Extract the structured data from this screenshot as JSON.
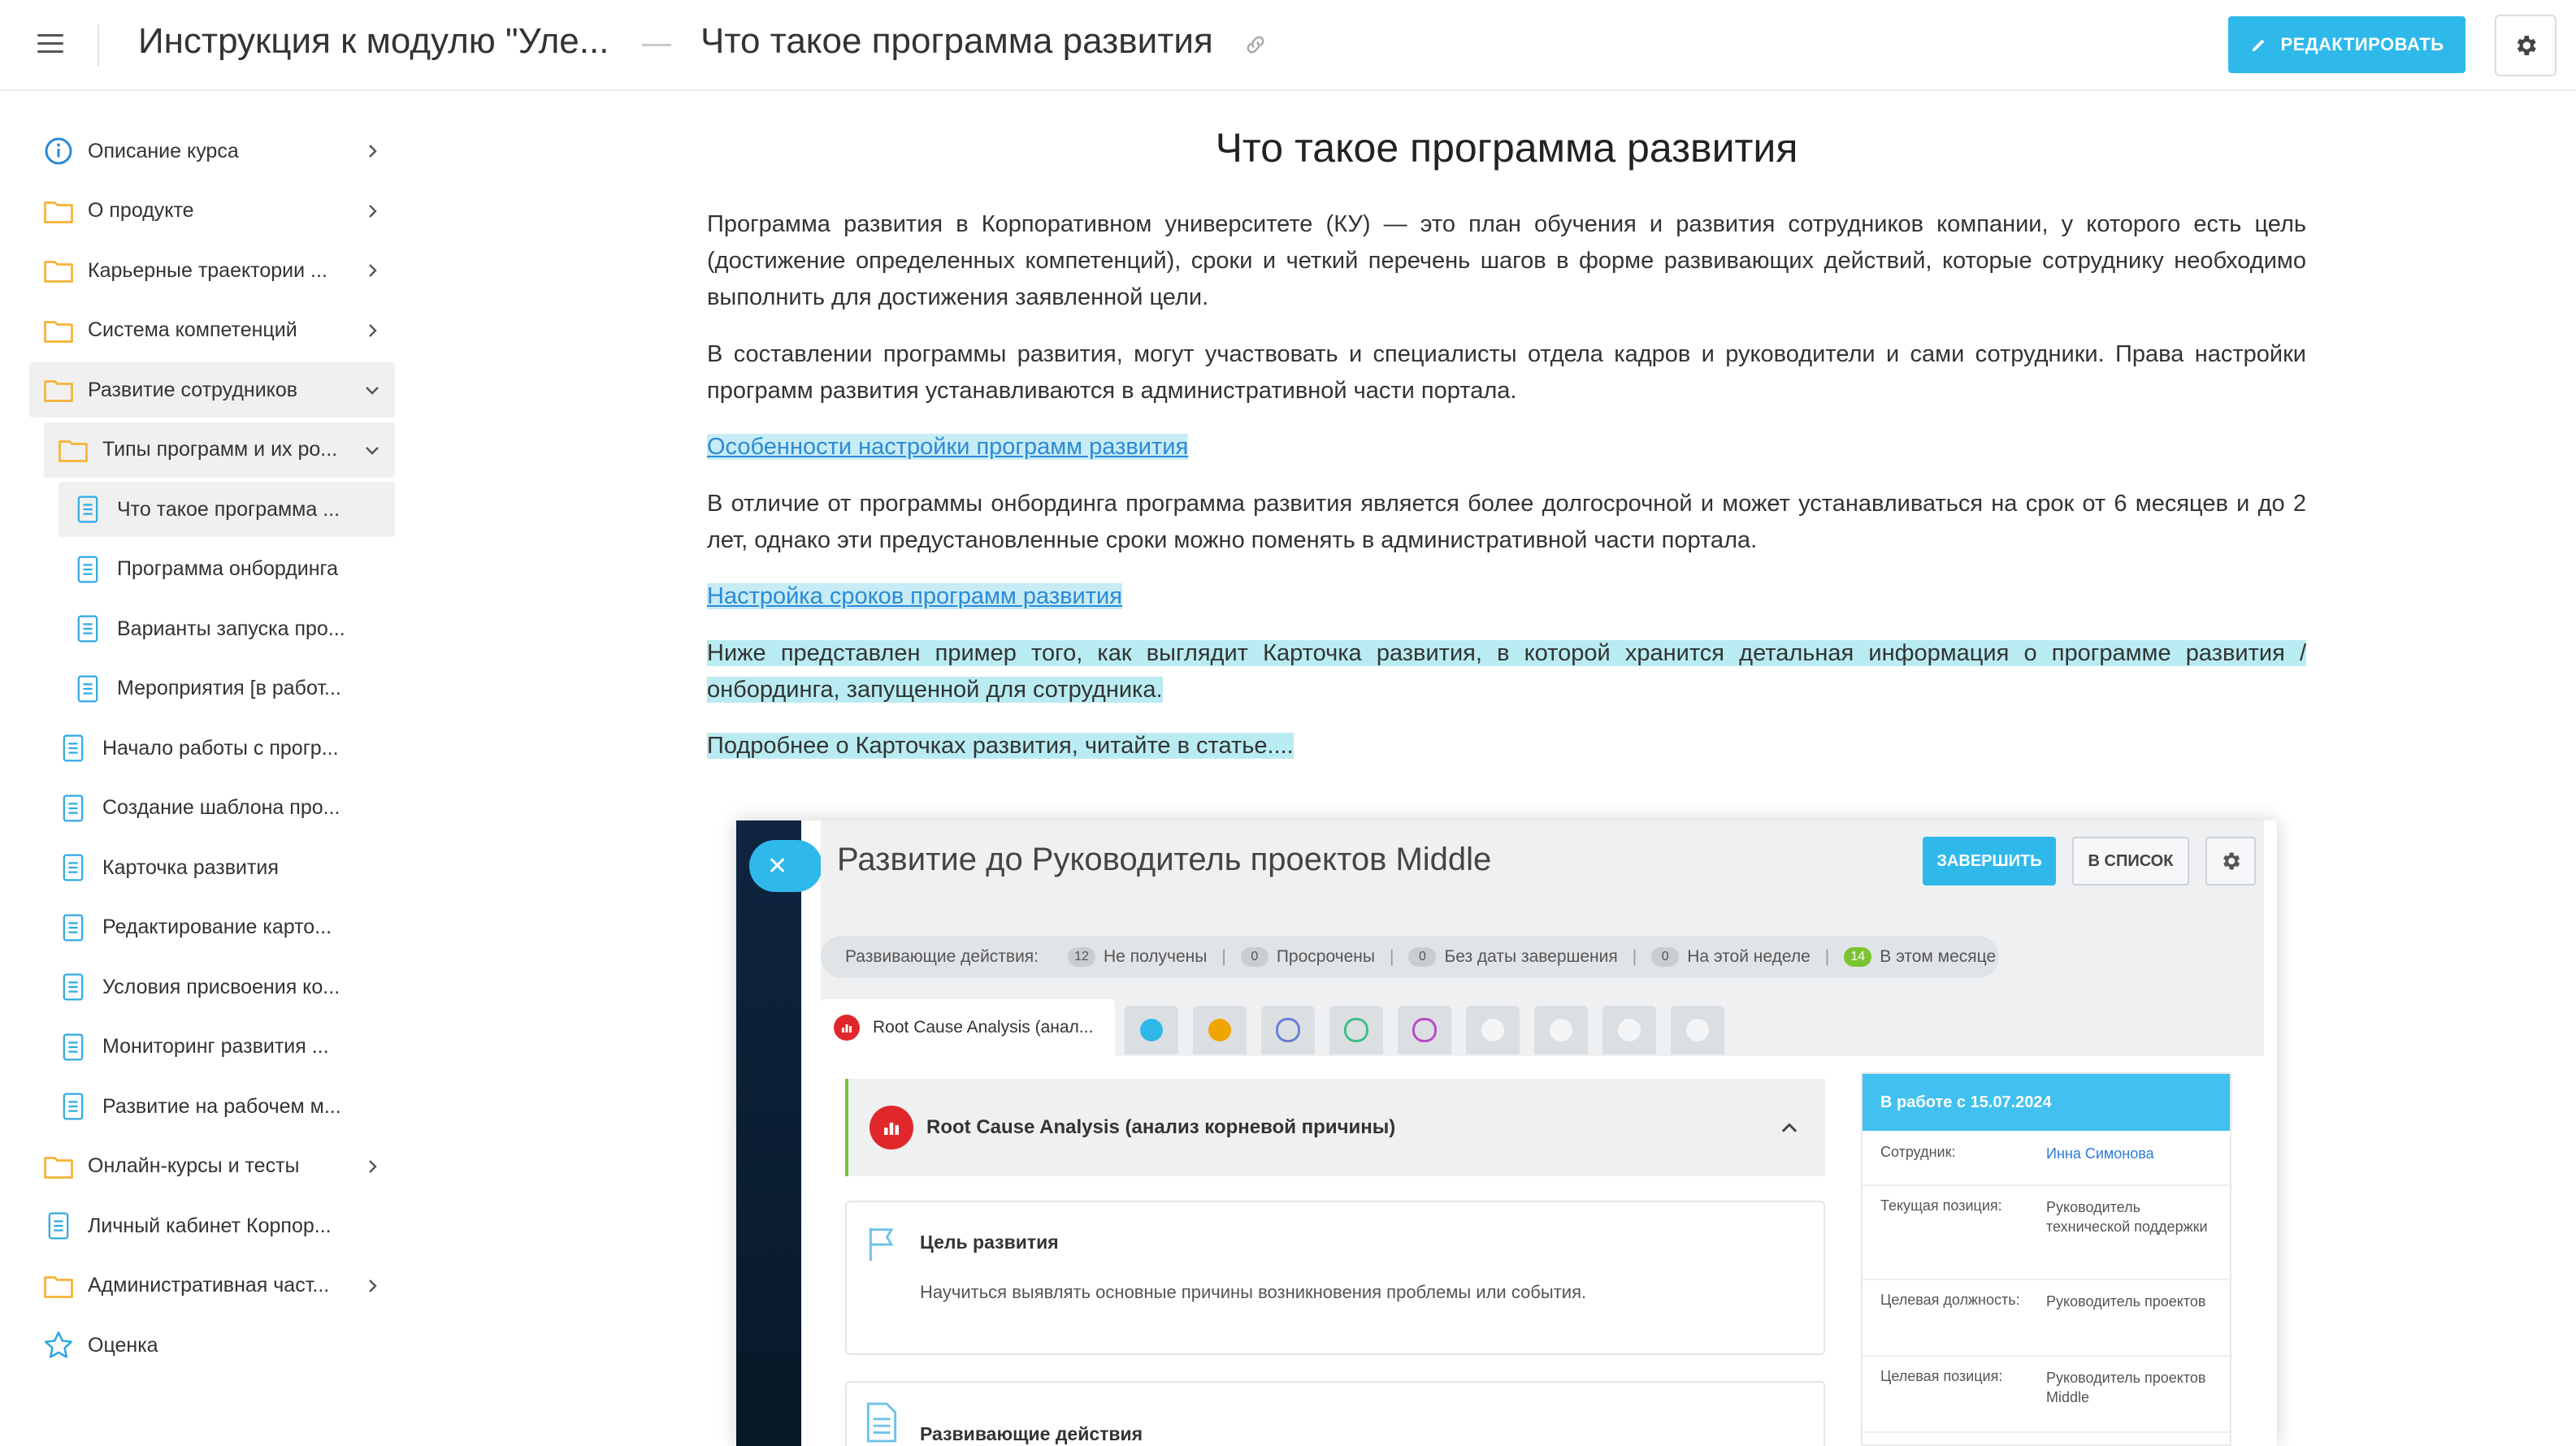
{
  "topbar": {
    "course_title": "Инструкция к модулю \"Уле...",
    "page_title": "Что такое программа развития",
    "edit_label": "РЕДАКТИРОВАТЬ"
  },
  "sidebar": {
    "items": [
      {
        "label": "Описание курса",
        "icon": "info-icon"
      },
      {
        "label": "О продукте",
        "icon": "folder-icon"
      },
      {
        "label": "Карьерные траектории ...",
        "icon": "folder-icon"
      },
      {
        "label": "Система компетенций",
        "icon": "folder-icon"
      },
      {
        "label": "Развитие сотрудников",
        "icon": "folder-icon"
      },
      {
        "label": "Типы программ и их ро...",
        "icon": "folder-icon"
      },
      {
        "label": "Что такое программа ...",
        "icon": "document-icon"
      },
      {
        "label": "Программа онбординга",
        "icon": "document-icon"
      },
      {
        "label": "Варианты запуска про...",
        "icon": "document-icon"
      },
      {
        "label": "Мероприятия [в работ...",
        "icon": "document-icon"
      },
      {
        "label": "Начало работы с прогр...",
        "icon": "document-icon"
      },
      {
        "label": "Создание шаблона про...",
        "icon": "document-icon"
      },
      {
        "label": "Карточка развития",
        "icon": "document-icon"
      },
      {
        "label": "Редактирование карто...",
        "icon": "document-icon"
      },
      {
        "label": "Условия присвоения ко...",
        "icon": "document-icon"
      },
      {
        "label": "Мониторинг развития ...",
        "icon": "document-icon"
      },
      {
        "label": "Развитие на рабочем м...",
        "icon": "document-icon"
      },
      {
        "label": "Онлайн-курсы и тесты",
        "icon": "folder-icon"
      },
      {
        "label": "Личный кабинет Корпор...",
        "icon": "document-icon"
      },
      {
        "label": "Административная част...",
        "icon": "folder-icon"
      },
      {
        "label": "Оценка",
        "icon": "star-icon"
      }
    ]
  },
  "article": {
    "heading": "Что такое программа развития",
    "p1": "Программа развития в Корпоративном университете (КУ) — это план обучения и развития сотрудников компании, у которого есть цель (достижение определенных компетенций), сроки и четкий перечень шагов в форме развивающих действий, которые сотруднику необходимо выполнить для достижения заявленной цели.",
    "p2": "В составлении программы развития, могут участвовать и специалисты отдела кадров и руководители и сами сотрудники. Права настройки программ развития устанавливаются в административной части портала.",
    "link1": "Особенности настройки программ развития",
    "p3": "В отличие от программы онбординга программа развития является более долгосрочной и может устанавливаться на срок от 6 месяцев и до 2 лет, однако эти предустановленные сроки можно поменять в административной части портала.",
    "link2": "Настройка сроков программ развития",
    "p4": "Ниже представлен пример того, как выглядит Карточка развития, в которой хранится детальная информация о программе развития / онбординга, запущенной для сотрудника.",
    "p5": "Подробнее о Карточках развития, читайте в статье...."
  },
  "embedded": {
    "title": "Развитие до Руководитель проектов Middle",
    "finish_label": "ЗАВЕРШИТЬ",
    "list_label": "В СПИСОК",
    "stats_label": "Развивающие действия:",
    "stats": [
      {
        "count": "12",
        "label": "Не получены"
      },
      {
        "count": "0",
        "label": "Просрочены"
      },
      {
        "count": "0",
        "label": "Без даты завершения"
      },
      {
        "count": "0",
        "label": "На этой неделе"
      },
      {
        "count": "14",
        "label": "В этом месяце"
      }
    ],
    "active_tab": "Root Cause Analysis (анал...",
    "accordion_title": "Root Cause Analysis (анализ корневой причины)",
    "goal_title": "Цель развития",
    "goal_text": "Научиться выявлять основные причины возникновения проблемы или события.",
    "actions_title": "Развивающие действия",
    "status_head": "В работе с 15.07.2024",
    "rows": [
      {
        "key": "Сотрудник:",
        "value": "Инна Симонова"
      },
      {
        "key": "Текущая позиция:",
        "value": "Руководитель технической поддержки"
      },
      {
        "key": "Целевая должность:",
        "value": "Руководитель проектов"
      },
      {
        "key": "Целевая позиция:",
        "value": "Руководитель проектов Middle"
      }
    ]
  },
  "colors": {
    "accent": "#2fb9ea",
    "folder": "#f5b335",
    "highlight": "#b8ecf2",
    "link": "#2b8ad6",
    "success": "#7cc330"
  }
}
